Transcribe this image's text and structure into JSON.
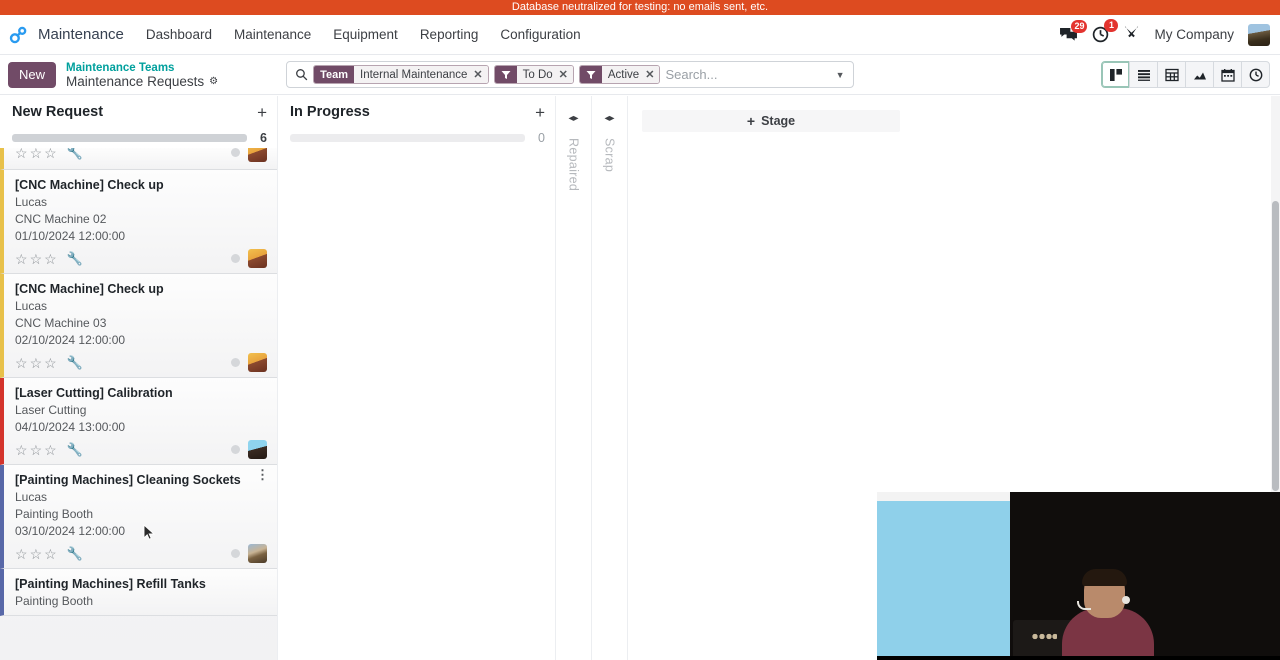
{
  "banner": {
    "text": "Database neutralized for testing: no emails sent, etc."
  },
  "navbar": {
    "app_name": "Maintenance",
    "logo_icon": "maintenance-link-icon",
    "menus": [
      {
        "label": "Dashboard"
      },
      {
        "label": "Maintenance"
      },
      {
        "label": "Equipment"
      },
      {
        "label": "Reporting"
      },
      {
        "label": "Configuration"
      }
    ],
    "messages_icon": "chat-bubbles-icon",
    "messages_count": "29",
    "activities_icon": "clock-icon",
    "activities_count": "1",
    "apps_icon": "maintenance-tools-icon",
    "company": "My Company",
    "avatar_icon": "user-avatar"
  },
  "control_panel": {
    "new_label": "New",
    "breadcrumb_parent": "Maintenance Teams",
    "breadcrumb_current": "Maintenance Requests",
    "settings_icon": "gear-icon",
    "search": {
      "search_icon": "search-icon",
      "placeholder": "Search...",
      "value": "",
      "facets": [
        {
          "key": "Team",
          "key_type": "text",
          "value": "Internal Maintenance",
          "remove_icon": "close-icon"
        },
        {
          "key": "",
          "key_type": "filter",
          "value": "To Do",
          "remove_icon": "close-icon"
        },
        {
          "key": "",
          "key_type": "filter",
          "value": "Active",
          "remove_icon": "close-icon"
        }
      ],
      "dropdown_icon": "chevron-down-icon"
    },
    "views": [
      {
        "name": "kanban",
        "icon": "kanban-icon",
        "active": true
      },
      {
        "name": "list",
        "icon": "list-icon",
        "active": false
      },
      {
        "name": "pivot",
        "icon": "pivot-table-icon",
        "active": false
      },
      {
        "name": "graph",
        "icon": "graph-icon",
        "active": false
      },
      {
        "name": "calendar",
        "icon": "calendar-icon",
        "active": false
      },
      {
        "name": "activity",
        "icon": "activity-clock-icon",
        "active": false
      }
    ]
  },
  "kanban": {
    "columns": [
      {
        "title": "New Request",
        "count": "6",
        "add_icon": "plus-icon",
        "progress_style": "full",
        "cards": [
          {
            "partial": true,
            "title": "",
            "person": "",
            "equipment": "",
            "date": "",
            "accent": "#e8c14a",
            "wrench_color": "#d4342c",
            "avatar_class": "av-a",
            "stars": 3
          },
          {
            "partial": false,
            "title": "[CNC Machine] Check up",
            "person": "Lucas",
            "equipment": "CNC Machine 02",
            "date": "01/10/2024 12:00:00",
            "accent": "#e8c14a",
            "wrench_color": "#d4342c",
            "avatar_class": "av-a",
            "stars": 3
          },
          {
            "partial": false,
            "title": "[CNC Machine] Check up",
            "person": "Lucas",
            "equipment": "CNC Machine 03",
            "date": "02/10/2024 12:00:00",
            "accent": "#e8c14a",
            "wrench_color": "#e0a02a",
            "avatar_class": "av-a",
            "stars": 3
          },
          {
            "partial": false,
            "title": "[Laser Cutting] Calibration",
            "person": "",
            "equipment": "Laser Cutting",
            "date": "04/10/2024 13:00:00",
            "accent": "#d4342c",
            "wrench_color": "#2a9d3f",
            "avatar_class": "av-b",
            "stars": 3
          },
          {
            "partial": false,
            "title": "[Painting Machines] Cleaning Sockets",
            "person": "Lucas",
            "equipment": "Painting Booth",
            "date": "03/10/2024 12:00:00",
            "accent": "#5868a8",
            "wrench_color": "#2a9d3f",
            "avatar_class": "av-c",
            "stars": 3,
            "menu_icon": "kebab-menu-icon"
          },
          {
            "partial": false,
            "title": "[Painting Machines] Refill Tanks",
            "person": "",
            "equipment": "Painting Booth",
            "date": "",
            "accent": "#5868a8",
            "wrench_color": "#2a9d3f",
            "avatar_class": "av-c",
            "stars": 0
          }
        ]
      },
      {
        "title": "In Progress",
        "count": "0",
        "add_icon": "plus-icon",
        "progress_style": "faint",
        "cards": []
      }
    ],
    "folded_columns": [
      {
        "label": "Repaired",
        "toggle_icon": "expand-column-icon"
      },
      {
        "label": "Scrap",
        "toggle_icon": "expand-column-icon"
      }
    ],
    "add_stage": {
      "label": "Stage",
      "plus_icon": "plus-icon"
    }
  },
  "overlay": {
    "name": "presenter-webcam-video"
  },
  "colors": {
    "brand_purple": "#714b67",
    "banner_red": "#dd4b20",
    "teal_link": "#00a09d",
    "badge_red": "#e3342f"
  }
}
